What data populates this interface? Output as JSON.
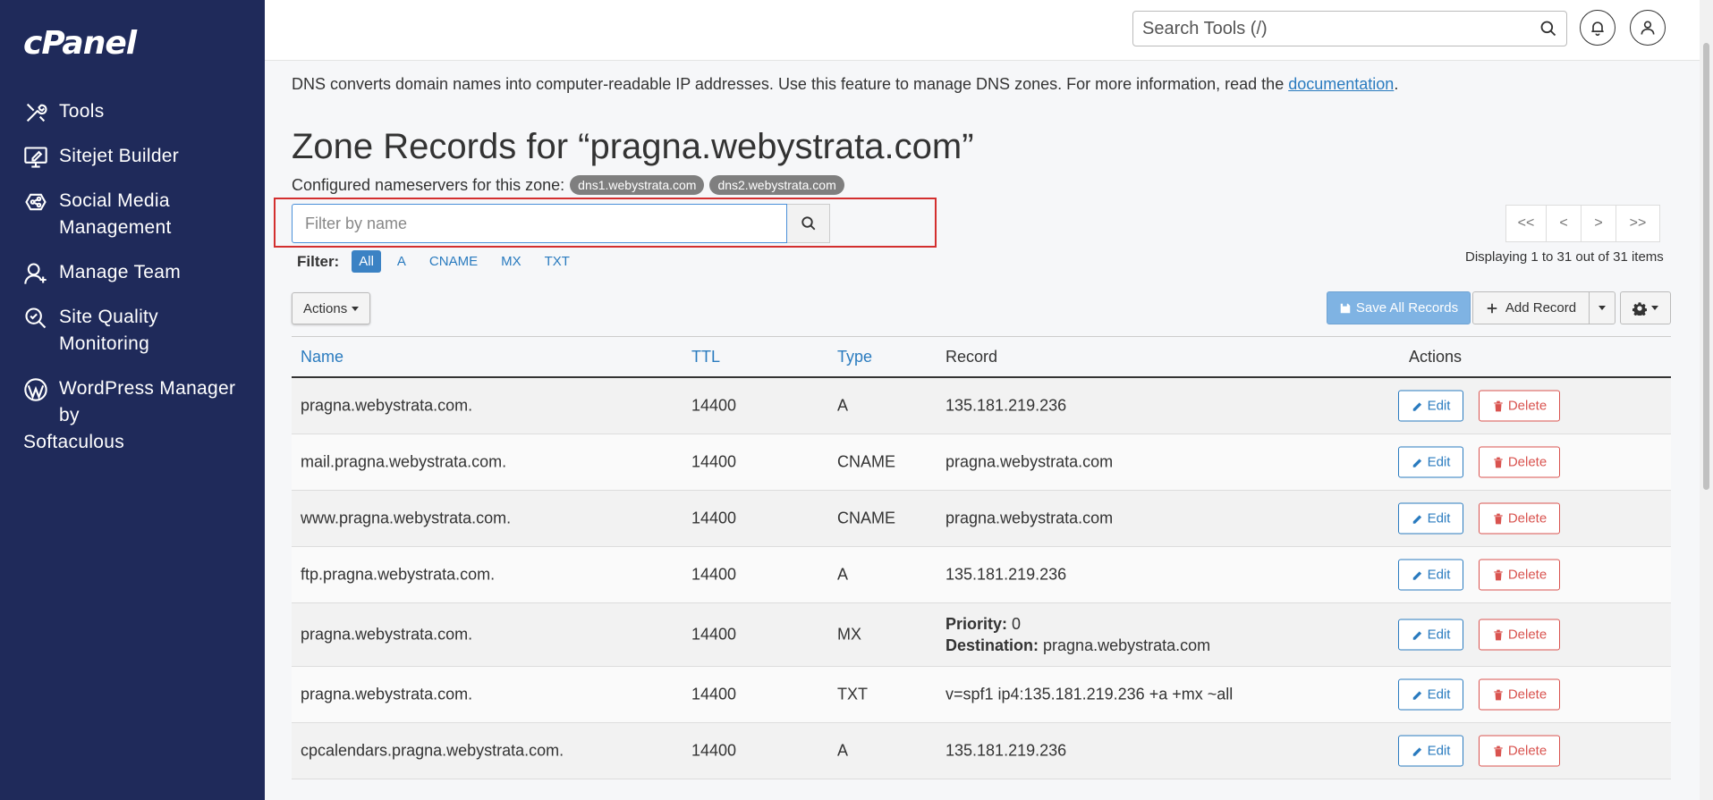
{
  "sidebar": {
    "logo": "cPanel",
    "items": [
      {
        "label": "Tools"
      },
      {
        "label": "Sitejet Builder"
      },
      {
        "label": "Social Media Management"
      },
      {
        "label": "Manage Team"
      },
      {
        "label": "Site Quality Monitoring"
      },
      {
        "label": "WordPress Manager by",
        "label2": "Softaculous"
      }
    ]
  },
  "header": {
    "search_placeholder": "Search Tools (/)"
  },
  "intro": {
    "text": "DNS converts domain names into computer-readable IP addresses. Use this feature to manage DNS zones. For more information, read the ",
    "link": "documentation",
    "after": "."
  },
  "page_title": "Zone Records for “pragna.webystrata.com”",
  "nameservers": {
    "label": "Configured nameservers for this zone:",
    "items": [
      "dns1.webystrata.com",
      "dns2.webystrata.com"
    ]
  },
  "filter": {
    "placeholder": "Filter by name",
    "label": "Filter:",
    "options": [
      "All",
      "A",
      "CNAME",
      "MX",
      "TXT"
    ],
    "active": "All"
  },
  "pager": {
    "first": "<<",
    "prev": "<",
    "next": ">",
    "last": ">>",
    "displaying": "Displaying 1 to 31 out of 31 items"
  },
  "toolbar": {
    "actions": "Actions",
    "save_all": "Save All Records",
    "add_record": "Add Record"
  },
  "table": {
    "headers": {
      "name": "Name",
      "ttl": "TTL",
      "type": "Type",
      "record": "Record",
      "actions": "Actions"
    },
    "edit_label": "Edit",
    "delete_label": "Delete",
    "rows": [
      {
        "name": "pragna.webystrata.com.",
        "ttl": "14400",
        "type": "A",
        "record": "135.181.219.236"
      },
      {
        "name": "mail.pragna.webystrata.com.",
        "ttl": "14400",
        "type": "CNAME",
        "record": "pragna.webystrata.com"
      },
      {
        "name": "www.pragna.webystrata.com.",
        "ttl": "14400",
        "type": "CNAME",
        "record": "pragna.webystrata.com"
      },
      {
        "name": "ftp.pragna.webystrata.com.",
        "ttl": "14400",
        "type": "A",
        "record": "135.181.219.236"
      },
      {
        "name": "pragna.webystrata.com.",
        "ttl": "14400",
        "type": "MX",
        "priority_label": "Priority:",
        "priority": "0",
        "destination_label": "Destination:",
        "destination": "pragna.webystrata.com"
      },
      {
        "name": "pragna.webystrata.com.",
        "ttl": "14400",
        "type": "TXT",
        "record": "v=spf1 ip4:135.181.219.236 +a +mx ~all"
      },
      {
        "name": "cpcalendars.pragna.webystrata.com.",
        "ttl": "14400",
        "type": "A",
        "record": "135.181.219.236"
      }
    ]
  }
}
